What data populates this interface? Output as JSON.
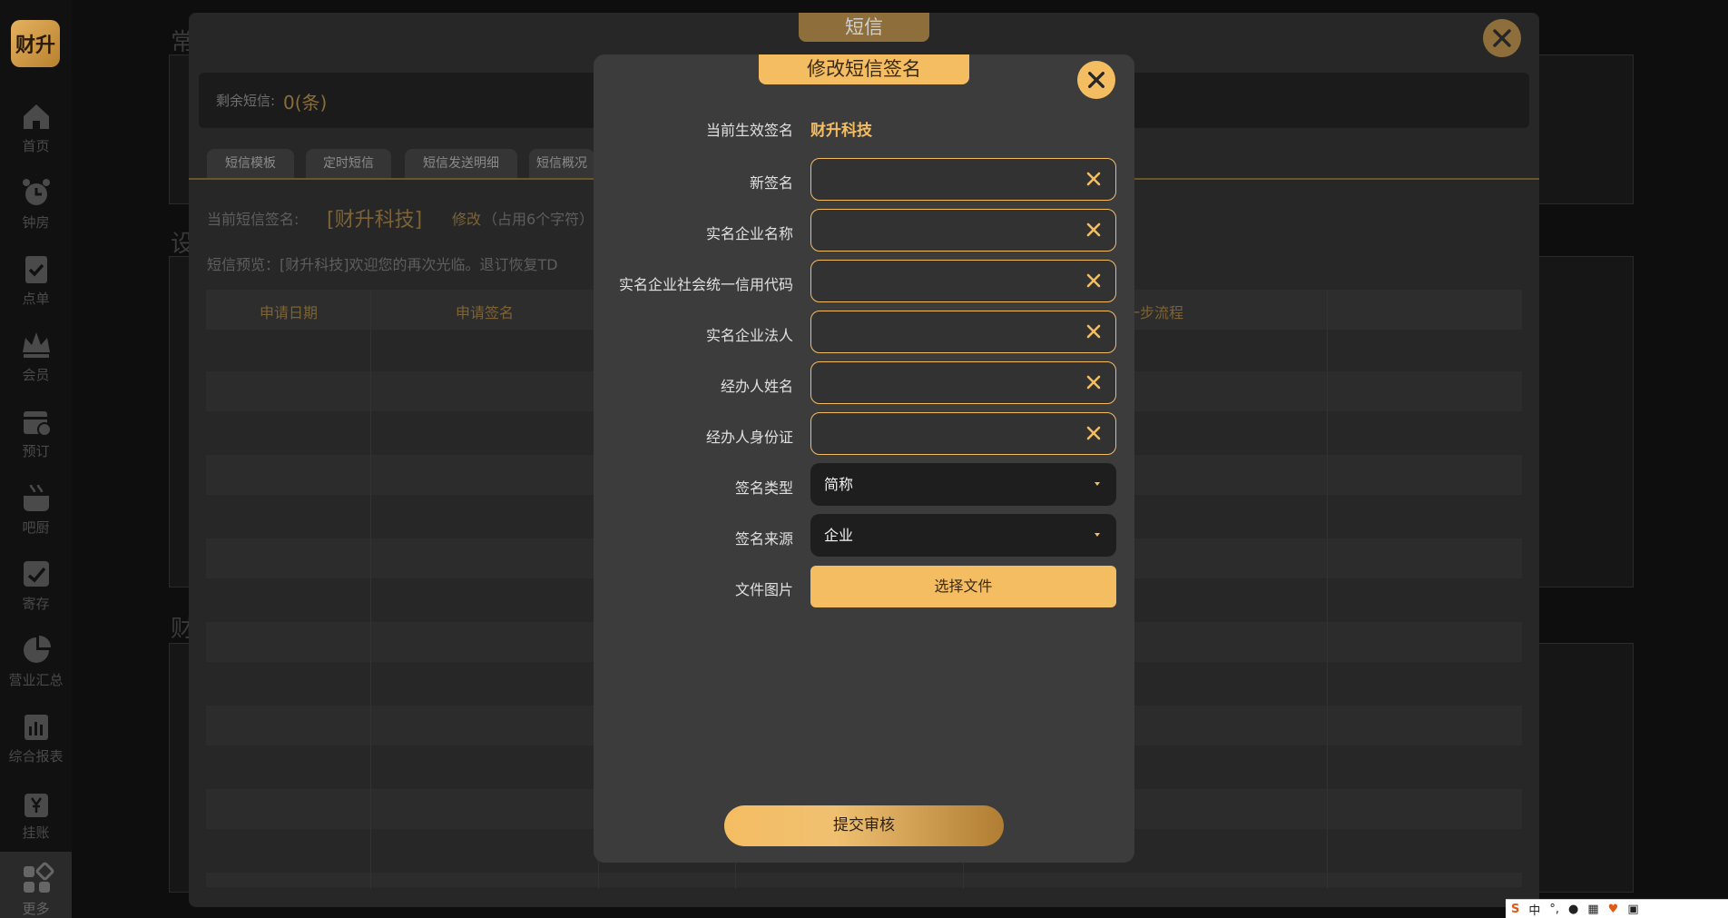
{
  "sidebar": {
    "logo": "财升",
    "items": [
      {
        "label": "首页",
        "icon": "home-icon"
      },
      {
        "label": "钟房",
        "icon": "alarm-clock-icon"
      },
      {
        "label": "点单",
        "icon": "clipboard-check-icon"
      },
      {
        "label": "会员",
        "icon": "crown-icon"
      },
      {
        "label": "预订",
        "icon": "calendar-clock-icon"
      },
      {
        "label": "吧厨",
        "icon": "pot-icon"
      },
      {
        "label": "寄存",
        "icon": "storage-check-icon"
      },
      {
        "label": "营业汇总",
        "icon": "pie-chart-icon"
      },
      {
        "label": "综合报表",
        "icon": "bar-report-icon"
      },
      {
        "label": "挂账",
        "icon": "yen-bag-icon"
      },
      {
        "label": "更多",
        "icon": "grid-more-icon"
      }
    ]
  },
  "background_page": {
    "letters": [
      "常",
      "设",
      "财"
    ]
  },
  "sms_modal": {
    "title": "短信",
    "remaining_label": "剩余短信:",
    "remaining_value": "0(条)",
    "tabs": [
      "短信模板",
      "定时短信",
      "短信发送明细",
      "短信概况"
    ],
    "current_sign_label": "当前短信签名:",
    "current_sign_value": "[财升科技]",
    "modify_link": "修改",
    "chars_note": "（占用6个字符）",
    "preview": "短信预览：[财升科技]欢迎您的再次光临。退订恢复TD",
    "table_headers": [
      "申请日期",
      "申请签名",
      "一步流程"
    ]
  },
  "edit_modal": {
    "title": "修改短信签名",
    "current_label": "当前生效签名",
    "current_value": "财升科技",
    "fields": [
      {
        "label": "新签名",
        "value": ""
      },
      {
        "label": "实名企业名称",
        "value": ""
      },
      {
        "label": "实名企业社会统一信用代码",
        "value": ""
      },
      {
        "label": "实名企业法人",
        "value": ""
      },
      {
        "label": "经办人姓名",
        "value": ""
      },
      {
        "label": "经办人身份证",
        "value": ""
      }
    ],
    "sign_type_label": "签名类型",
    "sign_type_value": "简称",
    "sign_source_label": "签名来源",
    "sign_source_value": "企业",
    "file_label": "文件图片",
    "file_button": "选择文件",
    "submit_button": "提交审核"
  },
  "colors": {
    "accent": "#f4bd62",
    "modal_bg": "#3c3c3c",
    "page_bg": "#0e0e0e"
  },
  "taskbar": {
    "ime": "中"
  }
}
